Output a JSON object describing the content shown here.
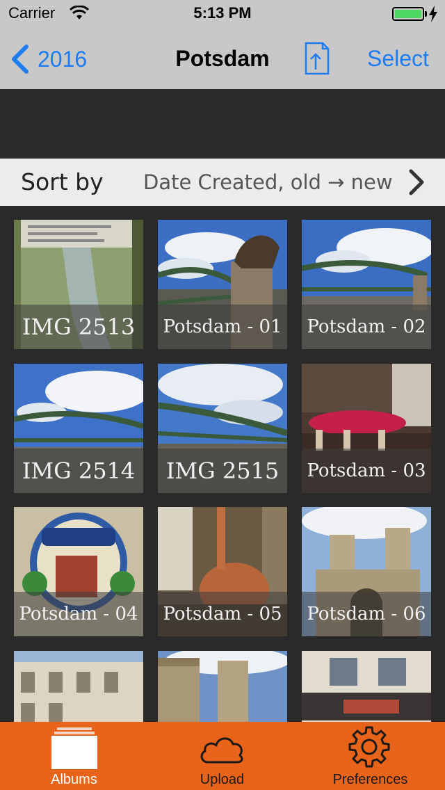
{
  "status_bar": {
    "carrier": "Carrier",
    "time": "5:13 PM",
    "battery_level": 1.0,
    "battery_color": "#4cd964",
    "icons": [
      "wifi-icon",
      "battery-icon",
      "charging-bolt-icon"
    ]
  },
  "nav": {
    "back_label": "2016",
    "title": "Potsdam",
    "select_label": "Select",
    "accent": "#1e7cf2",
    "icons": [
      "chevron-left-icon",
      "share-icon"
    ]
  },
  "sort": {
    "label": "Sort by",
    "value": "Date Created, old → new"
  },
  "photos": [
    {
      "caption": "IMG 2513"
    },
    {
      "caption": "Potsdam - 01"
    },
    {
      "caption": "Potsdam - 02"
    },
    {
      "caption": "IMG 2514"
    },
    {
      "caption": "IMG 2515"
    },
    {
      "caption": "Potsdam - 03"
    },
    {
      "caption": "Potsdam - 04"
    },
    {
      "caption": "Potsdam - 05"
    },
    {
      "caption": "Potsdam - 06"
    },
    {
      "caption": ""
    },
    {
      "caption": ""
    },
    {
      "caption": ""
    }
  ],
  "tabbar": {
    "background": "#e8641a",
    "tabs": [
      {
        "label": "Albums",
        "icon": "albums-icon",
        "active": true
      },
      {
        "label": "Upload",
        "icon": "cloud-icon",
        "active": false
      },
      {
        "label": "Preferences",
        "icon": "gear-icon",
        "active": false
      }
    ]
  }
}
